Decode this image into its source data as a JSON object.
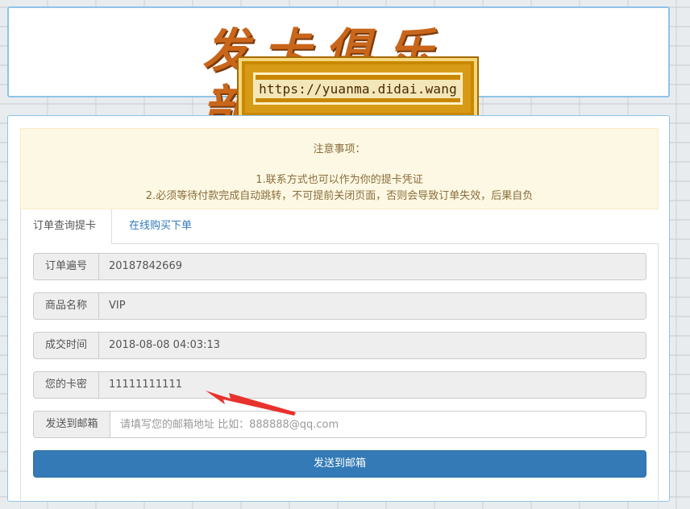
{
  "header": {
    "logo_text": "发卡俱乐部",
    "url_text": "https://yuanma.didai.wang"
  },
  "notice": {
    "title": "注意事项：",
    "line1": "1.联系方式也可以作为你的提卡凭证",
    "line2": "2.必须等待付款完成自动跳转，不可提前关闭页面，否则会导致订单失效，后果自负"
  },
  "tabs": [
    {
      "label": "订单查询提卡",
      "active": true
    },
    {
      "label": "在线购买下单",
      "active": false
    }
  ],
  "form": {
    "order_no": {
      "label": "订单遍号",
      "value": "20187842669"
    },
    "product": {
      "label": "商品名称",
      "value": "VIP"
    },
    "time": {
      "label": "成交时间",
      "value": "2018-08-08 04:03:13"
    },
    "card": {
      "label": "您的卡密",
      "value": "11111111111"
    },
    "email": {
      "label": "发送到邮箱",
      "placeholder": "请填写您的邮箱地址 比如：888888@qq.com"
    },
    "submit_label": "发送到邮箱"
  },
  "colors": {
    "primary": "#337ab7",
    "annotation_arrow": "#e8322d",
    "notice_bg": "#fcf8e3",
    "panel_border": "#8ec4e8"
  }
}
